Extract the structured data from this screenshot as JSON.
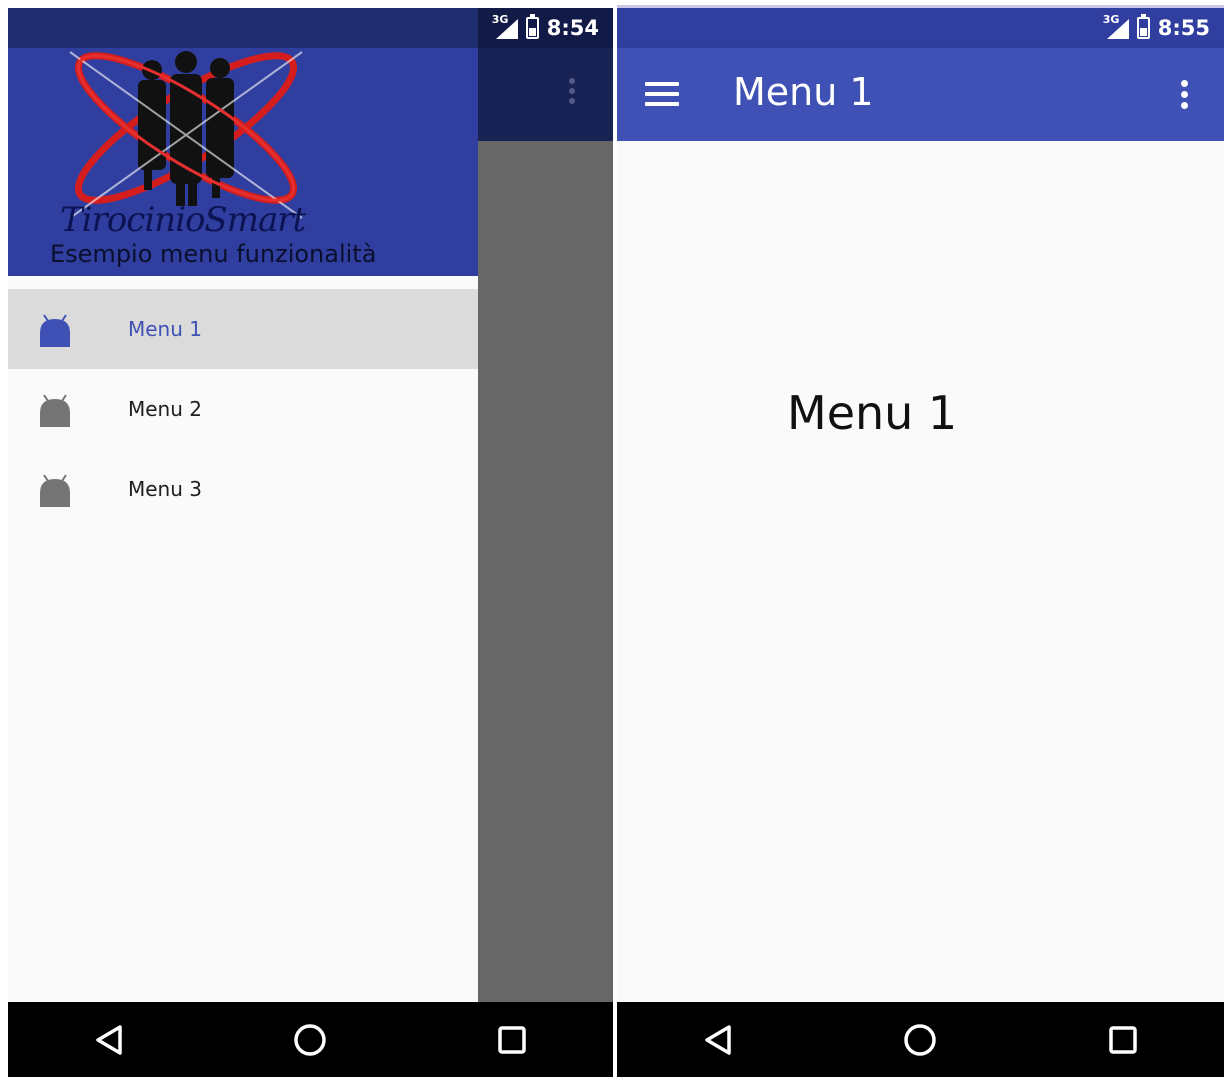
{
  "left_screen": {
    "status_bar": {
      "network": "3G",
      "time": "8:54"
    },
    "drawer": {
      "logo_text": "TirocinioSmart",
      "subtitle": "Esempio menu funzionalità",
      "items": [
        {
          "label": "Menu 1",
          "active": true
        },
        {
          "label": "Menu 2",
          "active": false
        },
        {
          "label": "Menu 3",
          "active": false
        }
      ]
    }
  },
  "right_screen": {
    "status_bar": {
      "network": "3G",
      "time": "8:55"
    },
    "toolbar": {
      "title": "Menu 1"
    },
    "content": {
      "text": "Menu 1"
    }
  },
  "colors": {
    "primary": "#3f51b5",
    "primary_dark": "#303f9f",
    "active_item_bg": "#dbdbdb",
    "scrim": "#676767",
    "logo_ring": "#d61d1d"
  },
  "icons": {
    "menu_item_icon": "android-icon",
    "nav_back": "back-triangle-icon",
    "nav_home": "home-circle-icon",
    "nav_recents": "recents-square-icon"
  }
}
